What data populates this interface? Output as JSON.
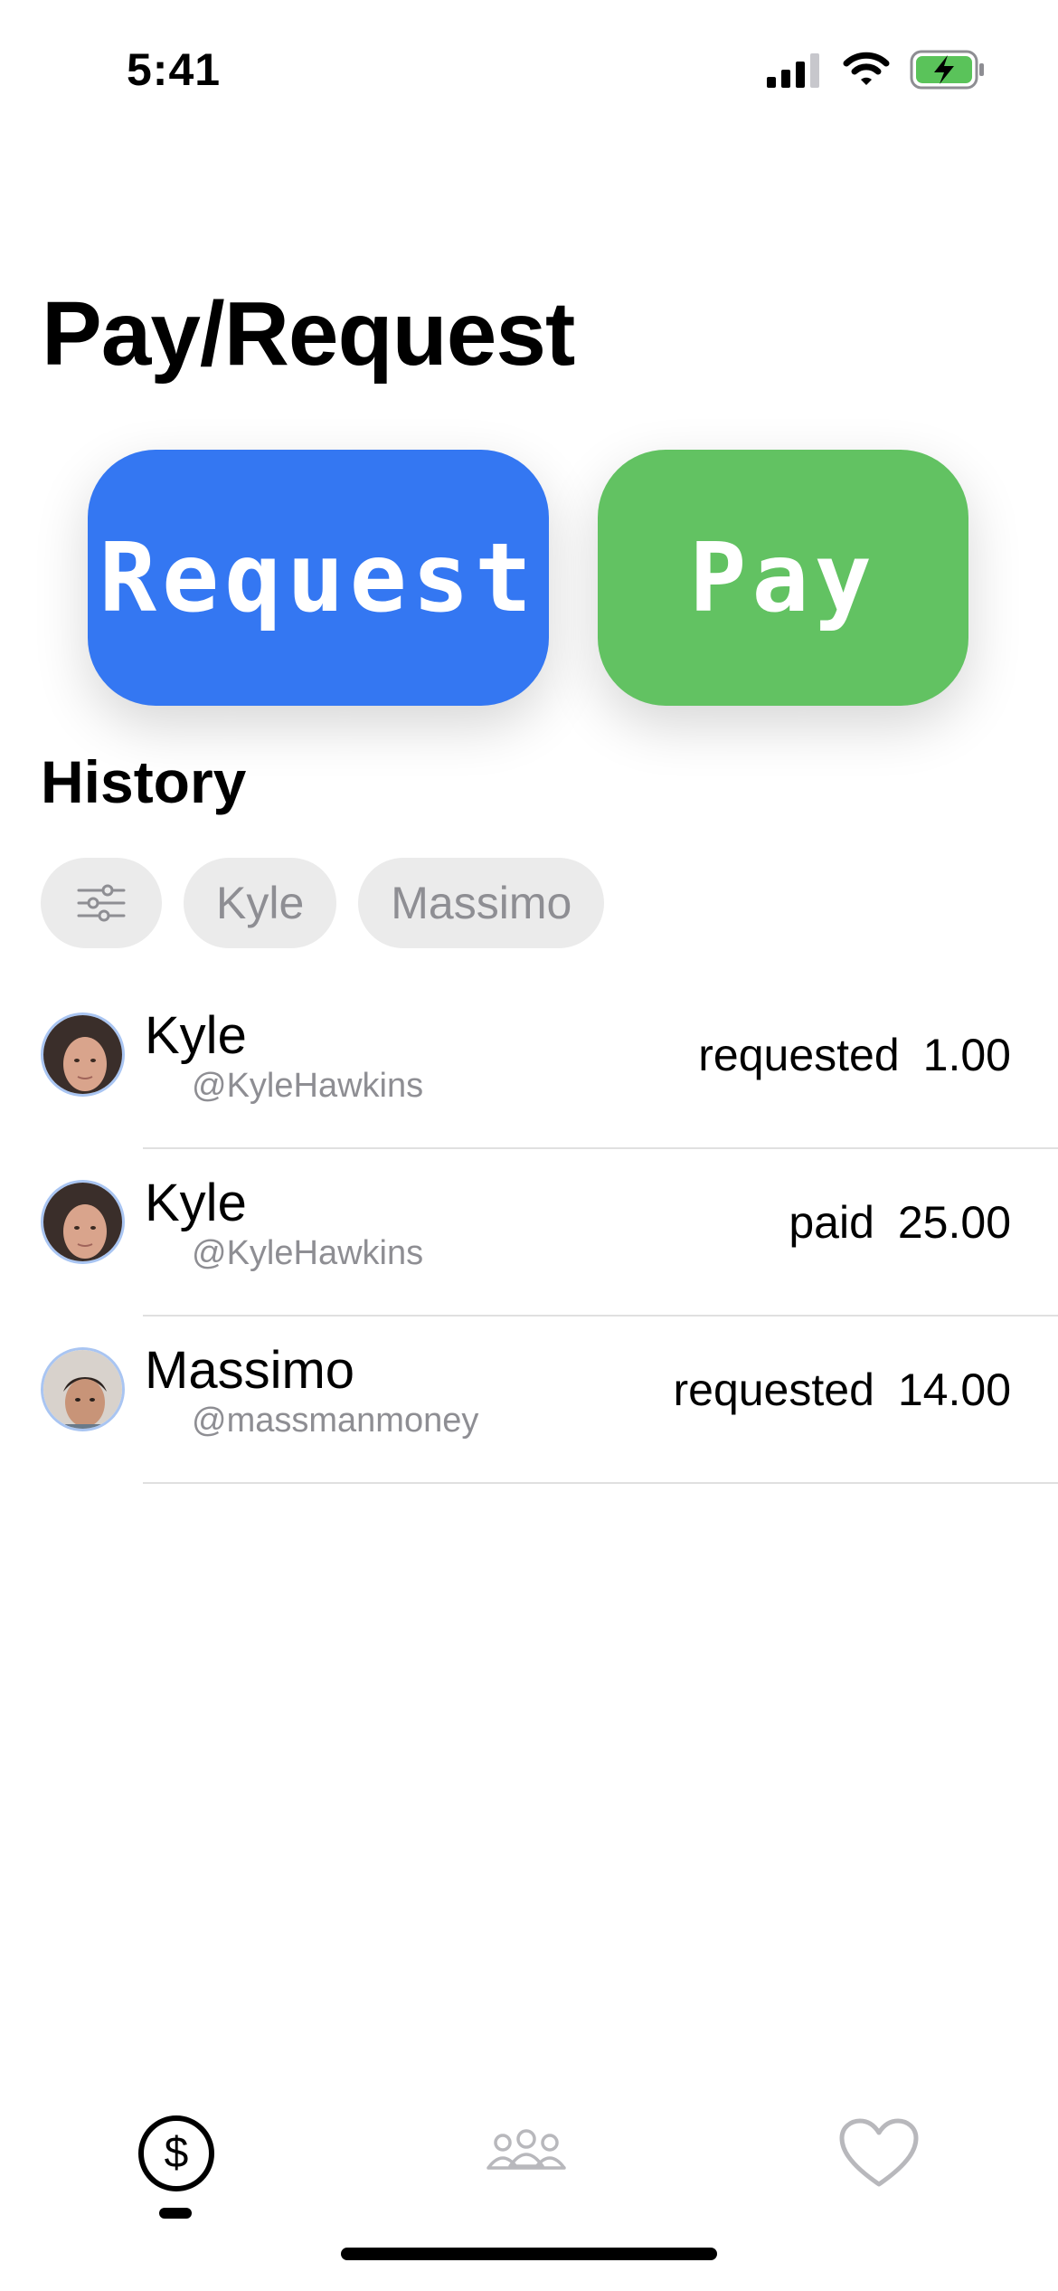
{
  "status_bar": {
    "time": "5:41"
  },
  "header": {
    "title": "Pay/Request"
  },
  "actions": {
    "request_label": "Request",
    "pay_label": "Pay",
    "request_color": "#3477f2",
    "pay_color": "#62c262"
  },
  "history": {
    "title": "History",
    "filters": [
      {
        "icon": "sliders-icon"
      },
      {
        "label": "Kyle"
      },
      {
        "label": "Massimo"
      }
    ],
    "items": [
      {
        "name": "Kyle",
        "handle": "@KyleHawkins",
        "action": "requested",
        "amount": "1.00"
      },
      {
        "name": "Kyle",
        "handle": "@KyleHawkins",
        "action": "paid",
        "amount": "25.00"
      },
      {
        "name": "Massimo",
        "handle": "@massmanmoney",
        "action": "requested",
        "amount": "14.00"
      }
    ]
  },
  "tab_bar": {
    "tabs": [
      {
        "icon": "dollar-circle-icon",
        "selected": true
      },
      {
        "icon": "people-icon",
        "selected": false
      },
      {
        "icon": "heart-icon",
        "selected": false
      }
    ]
  }
}
